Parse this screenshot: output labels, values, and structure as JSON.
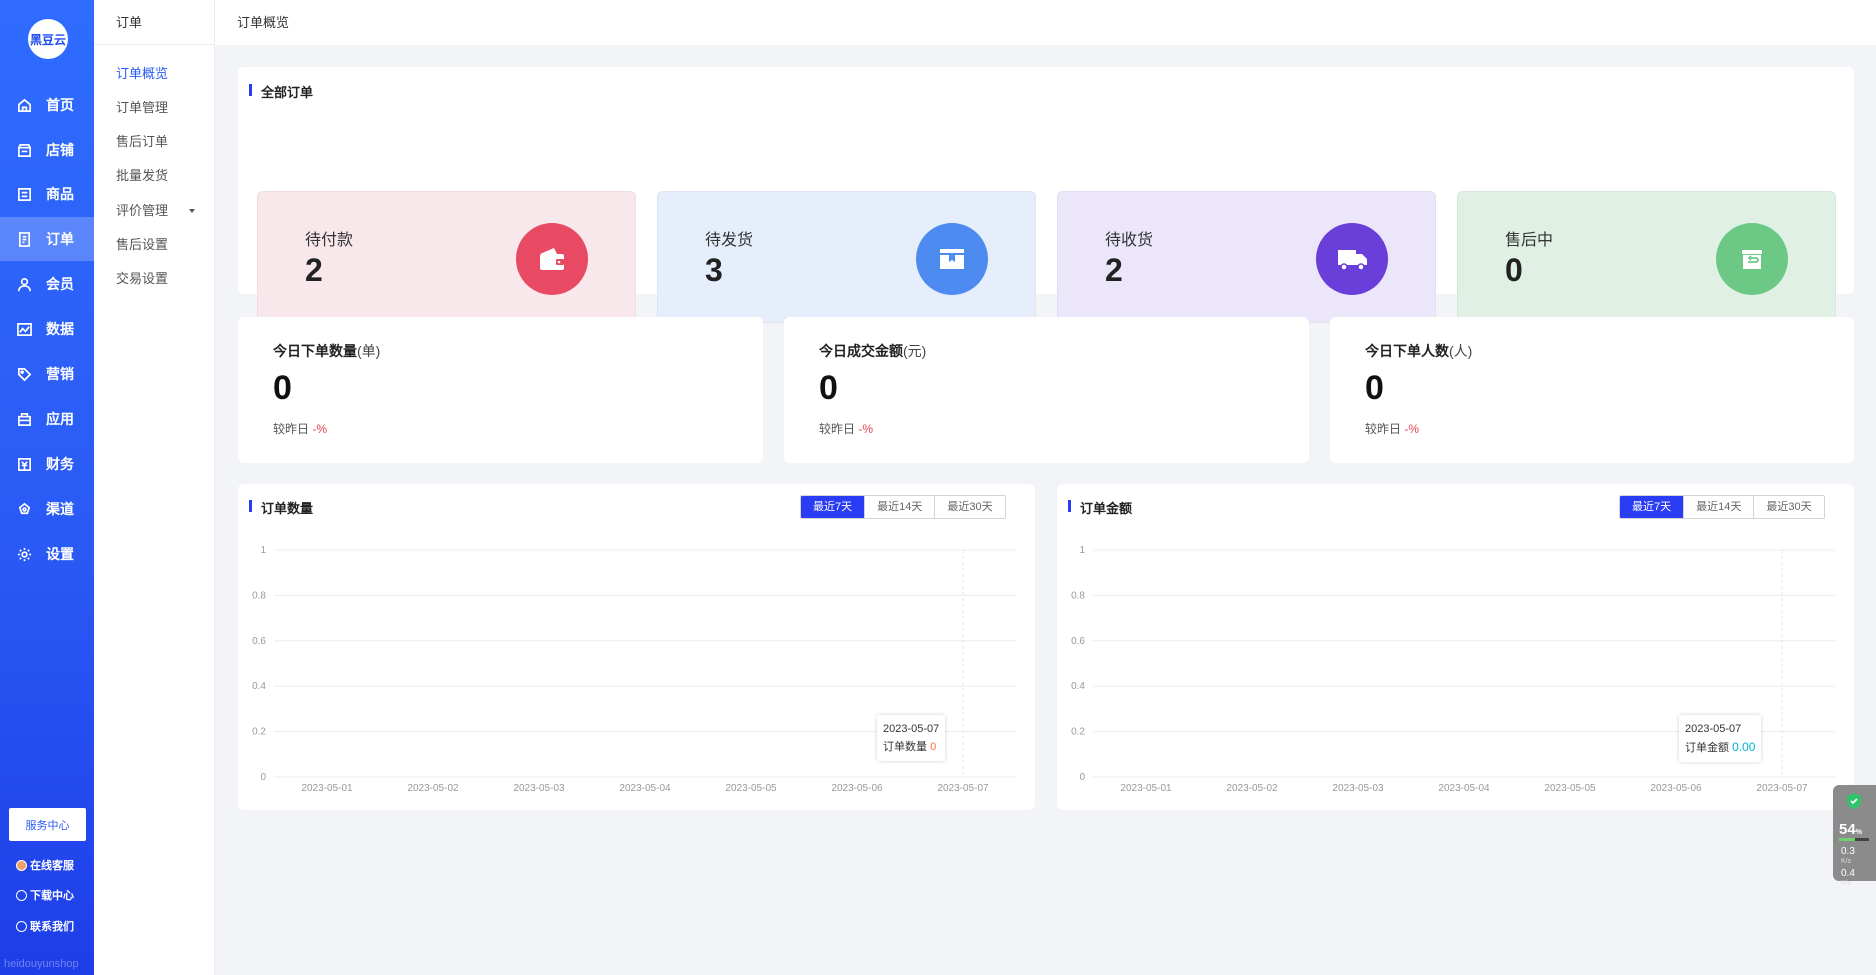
{
  "sidebar": {
    "logo": "黑豆云",
    "items": [
      {
        "label": "首页"
      },
      {
        "label": "店铺"
      },
      {
        "label": "商品"
      },
      {
        "label": "订单"
      },
      {
        "label": "会员"
      },
      {
        "label": "数据"
      },
      {
        "label": "营销"
      },
      {
        "label": "应用"
      },
      {
        "label": "财务"
      },
      {
        "label": "渠道"
      },
      {
        "label": "设置"
      }
    ],
    "active_index": 3,
    "service_center": "服务中心",
    "links": [
      {
        "label": "在线客服"
      },
      {
        "label": "下载中心"
      },
      {
        "label": "联系我们"
      }
    ],
    "watermark": "heidouyunshop"
  },
  "subnav": {
    "title": "订单",
    "items": [
      {
        "label": "订单概览"
      },
      {
        "label": "订单管理"
      },
      {
        "label": "售后订单"
      },
      {
        "label": "批量发货"
      },
      {
        "label": "评价管理"
      },
      {
        "label": "售后设置"
      },
      {
        "label": "交易设置"
      }
    ]
  },
  "breadcrumb": "订单概览",
  "all_orders": {
    "title": "全部订单",
    "cards": [
      {
        "label": "待付款",
        "value": "2",
        "bg": "#f9e8eb",
        "icon_bg": "#e84a63",
        "icon": "wallet-icon"
      },
      {
        "label": "待发货",
        "value": "3",
        "bg": "#e6eefc",
        "icon_bg": "#4d8bf0",
        "icon": "box-icon"
      },
      {
        "label": "待收货",
        "value": "2",
        "bg": "#ece6fa",
        "icon_bg": "#6a3ed8",
        "icon": "truck-icon"
      },
      {
        "label": "售后中",
        "value": "0",
        "bg": "#e0f0e4",
        "icon_bg": "#6cc985",
        "icon": "return-box-icon"
      }
    ]
  },
  "stats": [
    {
      "label": "今日下单数量",
      "unit": "(单)",
      "value": "0",
      "cmp_label": "较昨日",
      "cmp_value": "-%"
    },
    {
      "label": "今日成交金额",
      "unit": "(元)",
      "value": "0",
      "cmp_label": "较昨日",
      "cmp_value": "-%"
    },
    {
      "label": "今日下单人数",
      "unit": "(人)",
      "value": "0",
      "cmp_label": "较昨日",
      "cmp_value": "-%"
    }
  ],
  "charts": {
    "tabs": [
      "最近7天",
      "最近14天",
      "最近30天"
    ],
    "order_count": {
      "title": "订单数量",
      "tooltip_date": "2023-05-07",
      "tooltip_label": "订单数量",
      "tooltip_value": "0"
    },
    "order_amount": {
      "title": "订单金额",
      "tooltip_date": "2023-05-07",
      "tooltip_label": "订单金额",
      "tooltip_value": "0.00"
    }
  },
  "chart_data": [
    {
      "type": "line",
      "title": "订单数量",
      "x": [
        "2023-05-01",
        "2023-05-02",
        "2023-05-03",
        "2023-05-04",
        "2023-05-05",
        "2023-05-06",
        "2023-05-07"
      ],
      "series": [
        {
          "values": [
            0,
            0,
            0,
            0,
            0,
            0,
            0
          ]
        }
      ],
      "yticks": [
        "0",
        "0.2",
        "0.4",
        "0.6",
        "0.8",
        "1"
      ],
      "ylim": [
        0,
        1
      ],
      "grid": true
    },
    {
      "type": "line",
      "title": "订单金额",
      "x": [
        "2023-05-01",
        "2023-05-02",
        "2023-05-03",
        "2023-05-04",
        "2023-05-05",
        "2023-05-06",
        "2023-05-07"
      ],
      "series": [
        {
          "values": [
            0,
            0,
            0,
            0,
            0,
            0,
            0
          ]
        }
      ],
      "yticks": [
        "0",
        "0.2",
        "0.4",
        "0.6",
        "0.8",
        "1"
      ],
      "ylim": [
        0,
        1
      ],
      "grid": true
    }
  ],
  "widget": {
    "percent": "54",
    "percent_unit": "%",
    "up_speed": "0.3",
    "down_speed": "0.4",
    "speed_unit": "K/s"
  }
}
